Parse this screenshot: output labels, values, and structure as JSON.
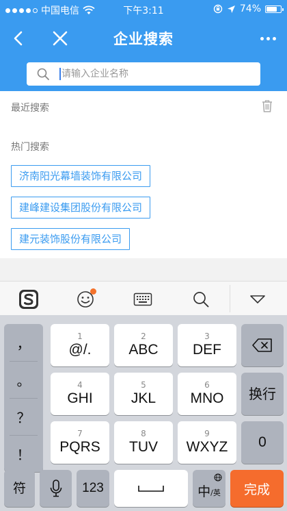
{
  "status_bar": {
    "carrier": "中国电信",
    "time": "下午3:11",
    "battery_text": "74%",
    "battery_level": 0.74,
    "signal_bars_filled": 4,
    "signal_bars_total": 5
  },
  "nav": {
    "title": "企业搜索",
    "back_icon": "chevron-left-icon",
    "close_icon": "close-icon",
    "more_icon": "more-dots-icon"
  },
  "search": {
    "placeholder": "请输入企业名称",
    "value": ""
  },
  "recent": {
    "label": "最近搜索",
    "clear_icon": "trash-icon"
  },
  "hot": {
    "label": "热门搜索",
    "tags": [
      "济南阳光幕墙装饰有限公司",
      "建峰建设集团股份有限公司",
      "建元装饰股份有限公司"
    ]
  },
  "keyboard_toolbar": {
    "icons": [
      "sogou-logo-icon",
      "emoji-icon",
      "keyboard-icon",
      "search-icon",
      "collapse-down-icon"
    ]
  },
  "keyboard": {
    "punctuation": [
      "，",
      "。",
      "？",
      "！"
    ],
    "rows": [
      [
        {
          "num": "1",
          "label": "@/."
        },
        {
          "num": "2",
          "label": "ABC"
        },
        {
          "num": "3",
          "label": "DEF"
        }
      ],
      [
        {
          "num": "4",
          "label": "GHI"
        },
        {
          "num": "5",
          "label": "JKL"
        },
        {
          "num": "6",
          "label": "MNO"
        }
      ],
      [
        {
          "num": "7",
          "label": "PQRS"
        },
        {
          "num": "8",
          "label": "TUV"
        },
        {
          "num": "9",
          "label": "WXYZ"
        }
      ]
    ],
    "backspace_icon": "backspace-icon",
    "newline_label": "换行",
    "zero_label": "0",
    "symbol_label": "符",
    "mic_icon": "microphone-icon",
    "num_label": "123",
    "space_icon": "space-icon",
    "lang_main": "中",
    "lang_sub": "/英",
    "globe_icon": "globe-icon",
    "done_label": "完成"
  },
  "colors": {
    "primary": "#3a9bf0",
    "accent": "#f56c2d",
    "tag_text": "#3a9bf0"
  }
}
